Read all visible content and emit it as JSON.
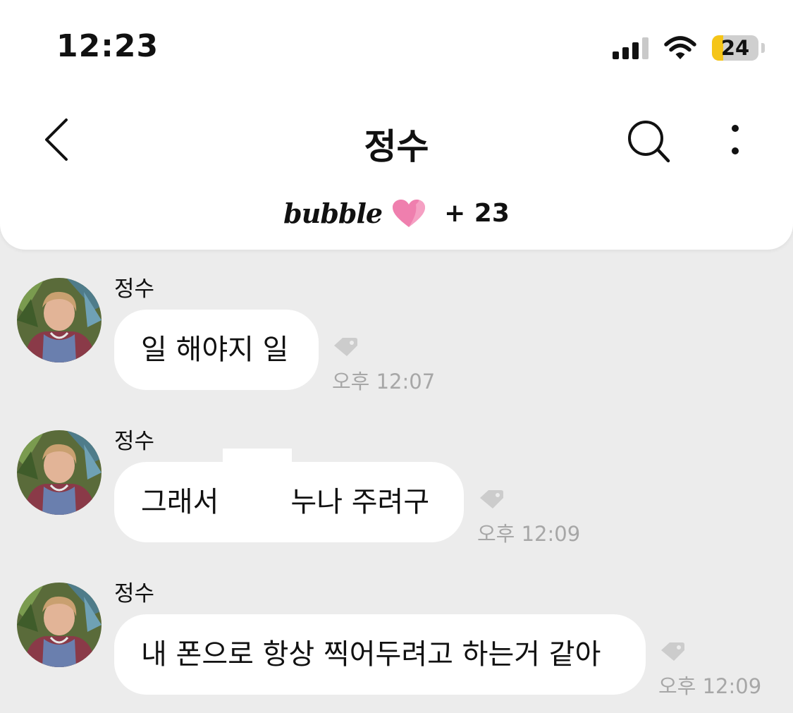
{
  "status_bar": {
    "time": "12:23",
    "battery": "24",
    "battery_level": 0.24
  },
  "header": {
    "title": "정수",
    "brand": "bubble",
    "badge": "+ 23"
  },
  "colors": {
    "background": "#ececec",
    "bubble": "#ffffff",
    "heart": "#ef7fae",
    "battery_fill": "#f5c518",
    "timestamp": "#a7a7a7"
  },
  "icons": [
    "back-chevron-icon",
    "search-icon",
    "more-vertical-icon",
    "heart-icon",
    "tag-icon"
  ],
  "messages": [
    {
      "sender": "정수",
      "text": "일 해야지 일",
      "time": "오후 12:07"
    },
    {
      "sender": "정수",
      "text_before": "그래서",
      "text_after": "누나 주려구",
      "time": "오후 12:09"
    },
    {
      "sender": "정수",
      "text": "내 폰으로 항상 찍어두려고 하는거 같아",
      "time": "오후 12:09"
    }
  ]
}
